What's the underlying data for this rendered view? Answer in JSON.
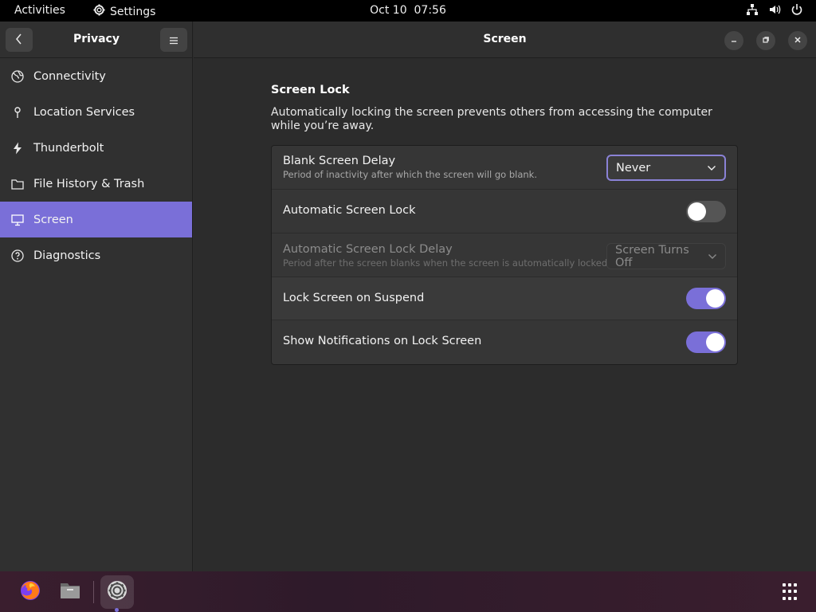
{
  "topbar": {
    "activities": "Activities",
    "app_name": "Settings",
    "date": "Oct 10",
    "time": "07:56",
    "tray_icons": [
      "network-icon",
      "volume-icon",
      "power-icon"
    ]
  },
  "sidebar": {
    "title": "Privacy",
    "items": [
      {
        "label": "Connectivity",
        "icon": "globe-icon",
        "active": false
      },
      {
        "label": "Location Services",
        "icon": "location-pin-icon",
        "active": false
      },
      {
        "label": "Thunderbolt",
        "icon": "thunderbolt-icon",
        "active": false
      },
      {
        "label": "File History & Trash",
        "icon": "folder-icon",
        "active": false
      },
      {
        "label": "Screen",
        "icon": "monitor-icon",
        "active": true
      },
      {
        "label": "Diagnostics",
        "icon": "question-icon",
        "active": false
      }
    ]
  },
  "main": {
    "title": "Screen",
    "section_title": "Screen Lock",
    "section_description": "Automatically locking the screen prevents others from accessing the computer while you’re away.",
    "rows": {
      "blank_delay": {
        "label": "Blank Screen Delay",
        "sublabel": "Period of inactivity after which the screen will go blank.",
        "value": "Never"
      },
      "auto_lock": {
        "label": "Automatic Screen Lock",
        "enabled": false
      },
      "auto_lock_delay": {
        "label": "Automatic Screen Lock Delay",
        "sublabel": "Period after the screen blanks when the screen is automatically locked.",
        "value": "Screen Turns Off"
      },
      "lock_on_suspend": {
        "label": "Lock Screen on Suspend",
        "enabled": true
      },
      "show_notifications": {
        "label": "Show Notifications on Lock Screen",
        "enabled": true
      }
    }
  },
  "colors": {
    "accent": "#7a6fd8",
    "topbar": "#000000",
    "sidebar": "#303030",
    "content": "#2c2c2c"
  },
  "dock": {
    "apps": [
      "firefox-icon",
      "files-icon",
      "settings-icon"
    ],
    "show_apps_icon": "app-grid-icon"
  }
}
